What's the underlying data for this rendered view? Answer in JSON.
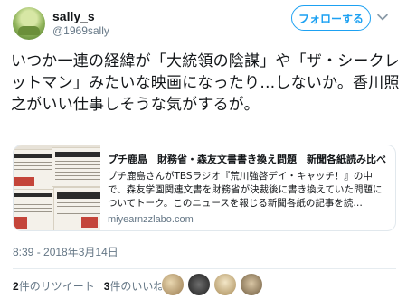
{
  "user": {
    "display_name": "sally_s",
    "handle": "@1969sally"
  },
  "follow_button": {
    "label": "フォローする"
  },
  "tweet": {
    "text": "いつか一連の経緯が「大統領の陰謀」や「ザ・シークレットマン」みたいな映画になったり…しないか。香川照之がいい仕事しそうな気がするが。",
    "timestamp": "8:39 - 2018年3月14日"
  },
  "card": {
    "title": "プチ鹿島　財務省・森友文書書き換え問題　新聞各紙読み比べ",
    "description": "プチ鹿島さんがTBSラジオ『荒川強啓デイ・キャッチ！』の中で、森友学園関連文書を財務省が決裁後に書き換えていた問題についてトーク。このニュースを報じる新聞各紙の記事を読…",
    "domain": "miyearnzzlabo.com"
  },
  "stats": {
    "retweets_count": "2",
    "retweets_label": "件のリツイート",
    "likes_count": "3",
    "likes_label": "件のいいね"
  },
  "colors": {
    "accent": "#1da1f2",
    "secondary_text": "#657786",
    "border": "#e1e8ed"
  },
  "icons": {
    "caret": "chevron-down-icon"
  }
}
